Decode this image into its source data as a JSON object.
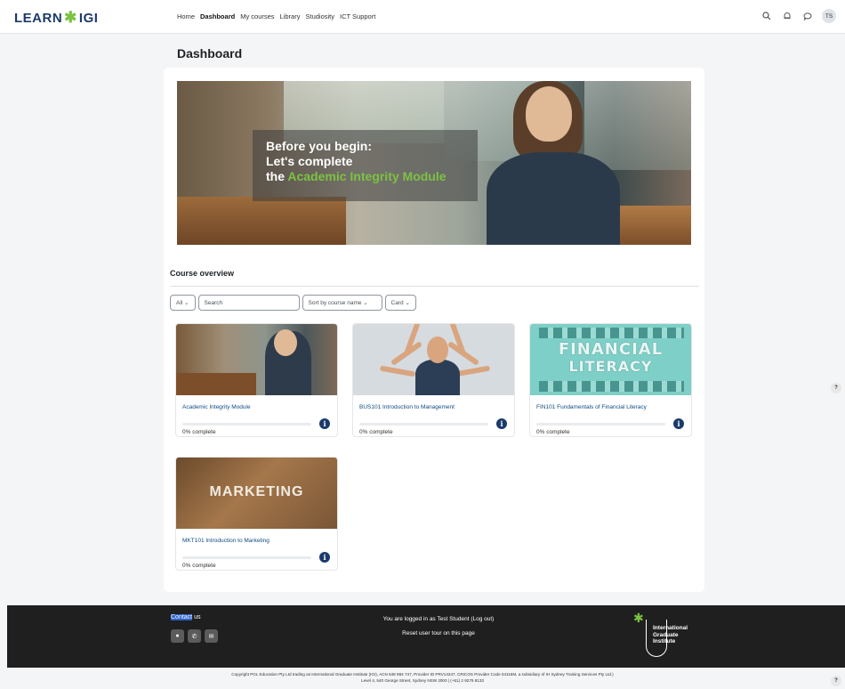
{
  "navbar": {
    "logo_left": "LEARN",
    "logo_right": "IGI",
    "links": [
      "Home",
      "Dashboard",
      "My courses",
      "Library",
      "Studiosity",
      "ICT Support"
    ],
    "active": "Dashboard",
    "avatar_initials": "TS"
  },
  "page": {
    "title": "Dashboard"
  },
  "hero": {
    "line1": "Before you begin:",
    "line2": "Let's complete",
    "line3_prefix": "the",
    "line3_highlight": "Academic Integrity Module"
  },
  "course_overview": {
    "title": "Course overview",
    "filter_all": "All",
    "search_placeholder": "Search",
    "sort": "Sort by course name",
    "view": "Card",
    "courses": [
      {
        "name": "Academic Integrity Module",
        "progress_percent": 0,
        "progress_text": "0% complete"
      },
      {
        "name": "BUS101 Introduction to Management",
        "progress_percent": 0,
        "progress_text": "0% complete"
      },
      {
        "name": "FIN101 Fundamentals of Financial Literacy",
        "progress_percent": 0,
        "progress_text": "0% complete"
      },
      {
        "name": "MKT101 Introduction to Marketing",
        "progress_percent": 0,
        "progress_text": "0% complete"
      }
    ],
    "image_words": {
      "fin_line1": "FINANCIAL",
      "fin_line2": "LITERACY",
      "mkt": "MARKETING"
    }
  },
  "footer": {
    "contact_highlight": "Contact",
    "contact_rest": " us",
    "logged_in": "You are logged in as Test Student (Log out)",
    "reset_tour": "Reset user tour on this page",
    "logo_line1": "International",
    "logo_line2": "Graduate",
    "logo_line3": "Institute",
    "copyright_line1": "Copyright PGL Education Pty Ltd trading as International Graduate Institute (IGI), ACN 648 984 747, Provider ID PRV14347, CRICOS Provider Code 04116M, a subsidiary of IH Sydney Training Services Pty Ltd.)",
    "copyright_line2": "Level 4, 540 George Street, Sydney NSW 2000 | (+61) 2 9279 8133"
  },
  "help_label": "?",
  "colors": {
    "brand_navy": "#1b3a6b",
    "brand_green": "#7cc242",
    "link_blue": "#0f4c81"
  }
}
